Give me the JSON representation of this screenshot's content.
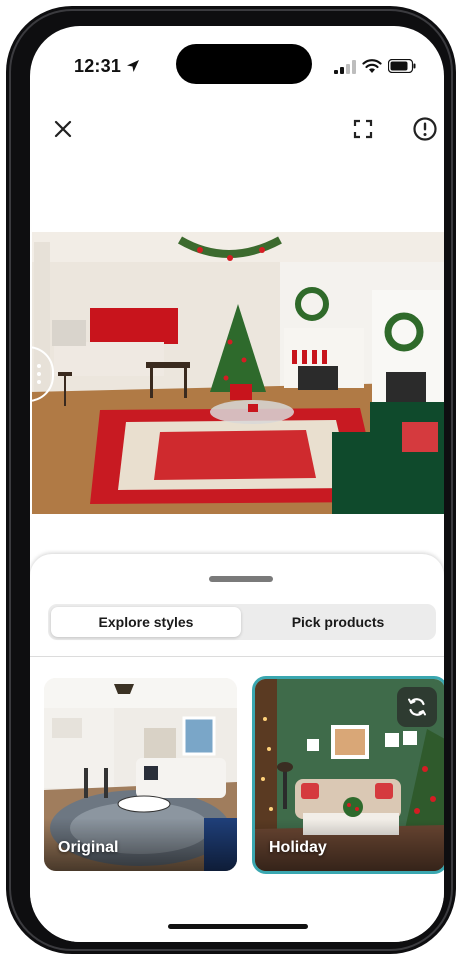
{
  "status_bar": {
    "time": "12:31",
    "icons": [
      "location-arrow-icon",
      "cellular-signal-icon",
      "wifi-icon",
      "battery-icon"
    ]
  },
  "toolbar": {
    "close_icon": "close-icon",
    "expand_icon": "expand-icon",
    "report_icon": "alert-circle-icon"
  },
  "hero": {
    "description_icon": "room-render-image",
    "compare_handle_icon": "drag-handle-icon"
  },
  "tabs": {
    "explore_label": "Explore styles",
    "pick_label": "Pick products",
    "selected": "Explore styles"
  },
  "styles": [
    {
      "label": "Original"
    },
    {
      "label": "Holiday",
      "selected": true
    }
  ],
  "colors": {
    "accent": "#3aa7b0",
    "segment_bg": "#ececec"
  }
}
